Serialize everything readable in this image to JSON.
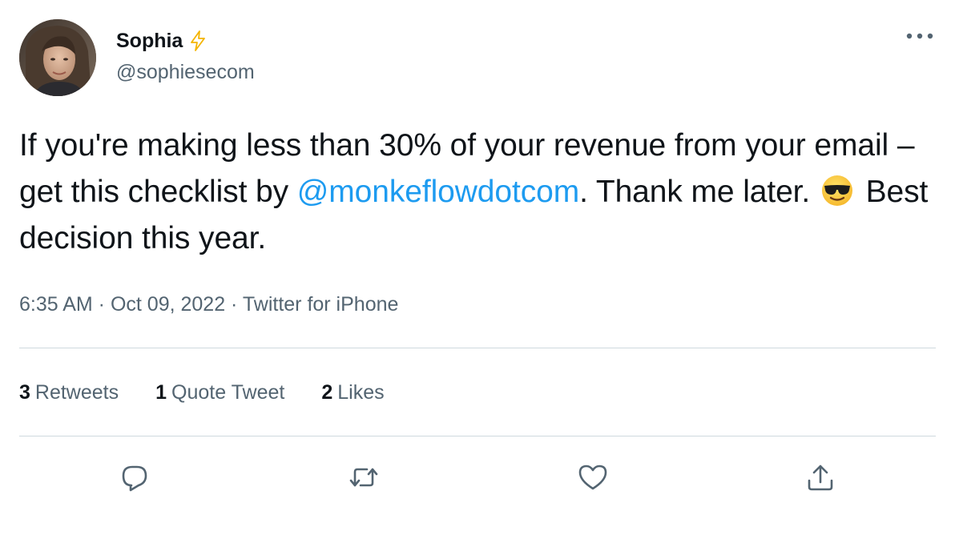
{
  "author": {
    "display_name": "Sophia",
    "handle": "@sophiesecom",
    "badge_icon": "lightning-bolt-icon",
    "avatar": "profile-photo"
  },
  "tweet": {
    "text_part1": "If you're making less than 30% of your revenue from your email – get this checklist by ",
    "mention": "@monkeflowdotcom",
    "text_part2": ". Thank me later. ",
    "emoji": "smiling-face-with-sunglasses",
    "text_part3": " Best decision this year."
  },
  "meta": {
    "time": "6:35 AM",
    "separator1": " · ",
    "date": "Oct 09, 2022",
    "separator2": " · ",
    "source": "Twitter for iPhone"
  },
  "stats": {
    "retweets_count": "3",
    "retweets_label": "Retweets",
    "quotes_count": "1",
    "quotes_label": "Quote Tweet",
    "likes_count": "2",
    "likes_label": "Likes"
  },
  "actions": {
    "reply": "reply-icon",
    "retweet": "retweet-icon",
    "like": "heart-icon",
    "share": "share-icon"
  },
  "colors": {
    "text": "#0f1419",
    "secondary": "#536471",
    "link": "#1d9bf0",
    "divider": "#cfd9de",
    "bolt": "#f4b400"
  }
}
